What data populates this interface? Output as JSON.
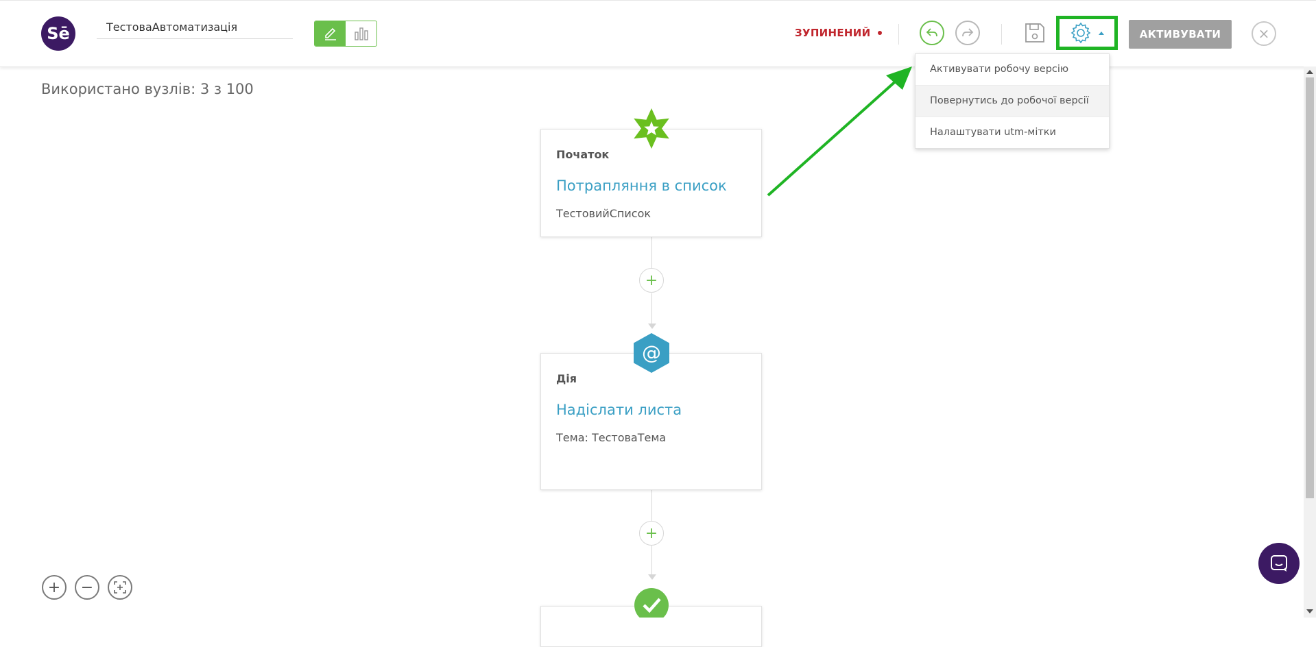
{
  "header": {
    "logo_text": "Sē",
    "automation_name": "ТестоваАвтоматизація",
    "status": "ЗУПИНЕНИЙ",
    "activate_label": "АКТИВУВАТИ",
    "close_symbol": "×"
  },
  "settings_menu": {
    "items": [
      {
        "label": "Активувати робочу версію"
      },
      {
        "label": "Повернутись до робочої версії"
      },
      {
        "label": "Налаштувати utm-мітки"
      }
    ]
  },
  "canvas": {
    "nodes_used": "Використано вузлів: 3 з 100",
    "nodes": [
      {
        "type": "Початок",
        "title": "Потрапляння в список",
        "desc": "ТестовийСписок",
        "icon": "star-icon"
      },
      {
        "type": "Дія",
        "title": "Надіслати листа",
        "desc": "Тема: ТестоваТема",
        "icon": "at-icon"
      }
    ],
    "add_symbol": "+",
    "zoom_in": "+",
    "zoom_out": "−"
  },
  "colors": {
    "brand": "#3c1a63",
    "accent_green": "#6abf4b",
    "highlight_green": "#1fb424",
    "status_red": "#c0262d",
    "link_blue": "#3a9fc4"
  }
}
